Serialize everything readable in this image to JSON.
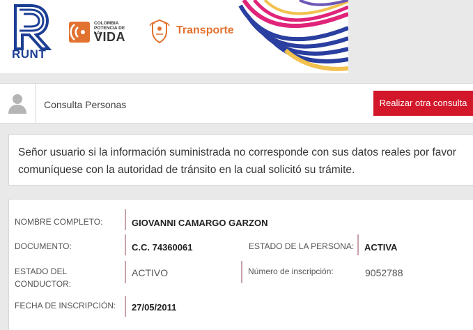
{
  "header": {
    "runt_label": "RUNT",
    "colombia_small": [
      "COLOMBIA",
      "POTENCIA DE LA"
    ],
    "colombia_big": "VIDA",
    "transporte_label": "Transporte"
  },
  "bar": {
    "title": "Consulta Personas",
    "button_label": "Realizar otra consulta"
  },
  "notice": {
    "text": "Señor usuario si la información suministrada no corresponde con sus datos reales por favor comuníquese con la autoridad de tránsito en la cual solicitó su trámite."
  },
  "person": {
    "nombre_label": "NOMBRE COMPLETO:",
    "nombre_value": "GIOVANNI CAMARGO GARZON",
    "documento_label": "DOCUMENTO:",
    "documento_value": "C.C. 74360061",
    "estado_persona_label": "ESTADO DE LA PERSONA:",
    "estado_persona_value": "ACTIVA",
    "estado_conductor_label_1": "ESTADO DEL",
    "estado_conductor_label_2": "CONDUCTOR:",
    "estado_conductor_value": "ACTIVO",
    "numero_inscripcion_label": "Número de inscripción:",
    "numero_inscripcion_value": "9052788",
    "fecha_inscripcion_label": "FECHA DE INSCRIPCIÓN:",
    "fecha_inscripcion_value": "27/05/2011"
  },
  "colors": {
    "runt_blue": "#1c3f94",
    "transporte_orange": "#e2722f",
    "button_red": "#d2172a",
    "separator_pink": "#c9a3aa"
  }
}
